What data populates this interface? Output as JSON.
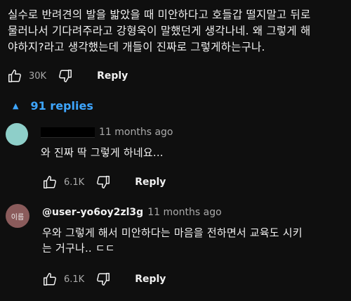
{
  "comment": {
    "text": "실수로 반려견의 발을 밟았을 때 미안하다고 호들갑 떨지말고 뒤로\n물러나서 기다려주라고 강형욱이 말했던게 생각나네. 왜 그렇게 해\n야하지?라고 생각했는데 개들이 진짜로 그렇게하는구나.",
    "like_count": "30K",
    "reply_label": "Reply",
    "like_icon": "thumb-up-icon",
    "dislike_icon": "thumb-down-icon"
  },
  "replies_toggle": {
    "label": "91 replies",
    "icon": "caret-up-icon"
  },
  "replies": [
    {
      "author": "",
      "author_redacted": true,
      "avatar_color": "#8ecfc9",
      "time": "11 months ago",
      "text": "와 진짜 딱 그렇게 하네요...",
      "like_count": "6.1K",
      "reply_label": "Reply"
    },
    {
      "author": "@user-yo6oy2zl3g",
      "avatar_label": "이름",
      "avatar_color": "#8a5b5b",
      "time": "11 months ago",
      "text": "우와 그렇게 해서 미안하다는 마음을 전하면서 교육도 시키\n는 거구나.. ㄷㄷ",
      "like_count": "6.1K",
      "reply_label": "Reply"
    }
  ],
  "colors": {
    "background": "#0f0f0f",
    "text": "#f1f1f1",
    "secondary_text": "#aaaaaa",
    "link_blue": "#3ea6ff"
  }
}
